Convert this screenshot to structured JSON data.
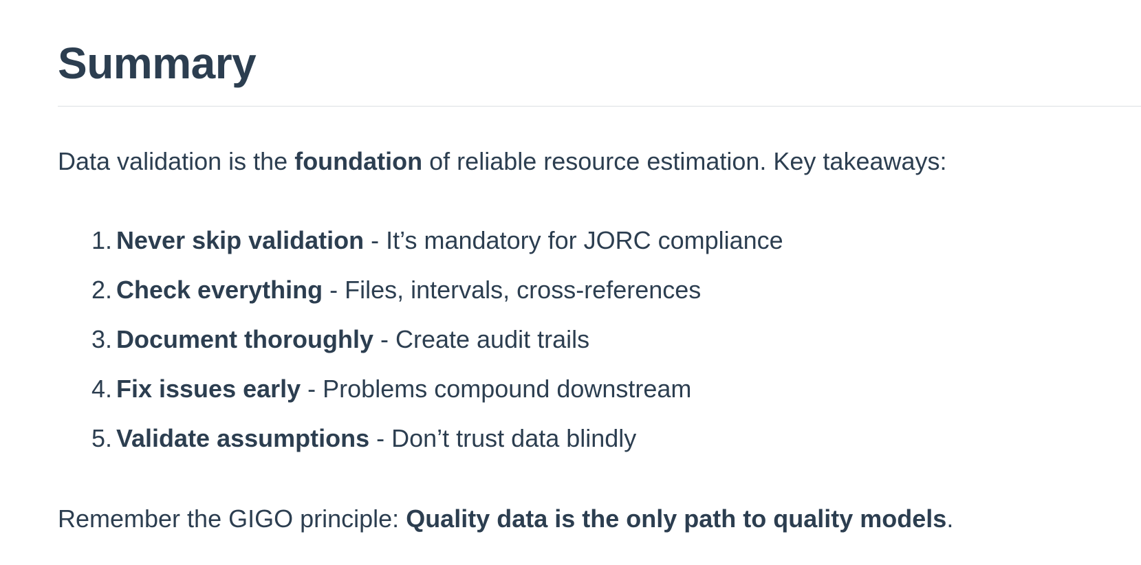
{
  "title": "Summary",
  "intro": {
    "prefix": "Data validation is the ",
    "emphasis": "foundation",
    "suffix": " of reliable resource estimation. Key takeaways:"
  },
  "takeaways": [
    {
      "number": "1.",
      "bold": "Never skip validation",
      "rest": " - It’s mandatory for JORC compliance"
    },
    {
      "number": "2.",
      "bold": "Check everything",
      "rest": " - Files, intervals, cross-references"
    },
    {
      "number": "3.",
      "bold": "Document thoroughly",
      "rest": " - Create audit trails"
    },
    {
      "number": "4.",
      "bold": "Fix issues early",
      "rest": " - Problems compound downstream"
    },
    {
      "number": "5.",
      "bold": "Validate assumptions",
      "rest": " - Don’t trust data blindly"
    }
  ],
  "outro": {
    "prefix": "Remember the GIGO principle: ",
    "emphasis": "Quality data is the only path to quality models",
    "suffix": "."
  },
  "colors": {
    "text": "#2c3e50",
    "rule": "#dcdfe3",
    "background": "#ffffff"
  }
}
